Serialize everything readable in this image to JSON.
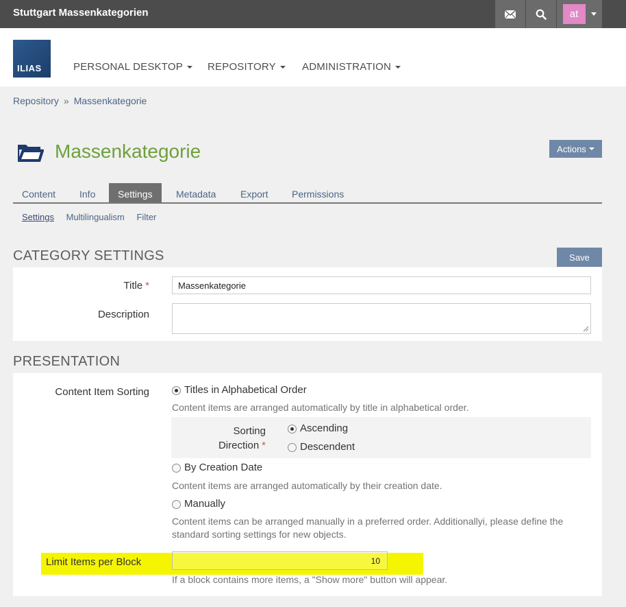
{
  "topbar": {
    "title": "Stuttgart Massenkategorien",
    "user_initials": "at"
  },
  "header": {
    "logo_text": "ILIAS",
    "nav": [
      {
        "label": "PERSONAL DESKTOP"
      },
      {
        "label": "REPOSITORY"
      },
      {
        "label": "ADMINISTRATION"
      }
    ]
  },
  "breadcrumb": {
    "items": [
      "Repository",
      "Massenkategorie"
    ],
    "separator": "»"
  },
  "page": {
    "title": "Massenkategorie",
    "actions_label": "Actions"
  },
  "tabs": [
    {
      "label": "Content"
    },
    {
      "label": "Info"
    },
    {
      "label": "Settings",
      "active": true
    },
    {
      "label": "Metadata"
    },
    {
      "label": "Export"
    },
    {
      "label": "Permissions"
    }
  ],
  "subtabs": [
    {
      "label": "Settings",
      "active": true
    },
    {
      "label": "Multilingualism"
    },
    {
      "label": "Filter"
    }
  ],
  "category_settings": {
    "heading": "CATEGORY SETTINGS",
    "save_label": "Save",
    "title_label": "Title",
    "required_mark": "*",
    "title_value": "Massenkategorie",
    "description_label": "Description",
    "description_value": ""
  },
  "presentation": {
    "heading": "PRESENTATION",
    "sorting_label": "Content Item Sorting",
    "options": {
      "alpha": {
        "label": "Titles in Alphabetical Order",
        "help": "Content items are arranged automatically by title in alphabetical order.",
        "selected": true
      },
      "creation": {
        "label": "By Creation Date",
        "help": "Content items are arranged automatically by their creation date.",
        "selected": false
      },
      "manual": {
        "label": "Manually",
        "help_line1": "Content items can be arranged manually in a preferred order. Additionallyi, please define the",
        "help_line2": "standard sorting settings for new objects.",
        "selected": false
      }
    },
    "direction": {
      "label_line1": "Sorting",
      "label_line2": "Direction",
      "required_mark": "*",
      "ascending": "Ascending",
      "descendent": "Descendent",
      "selected": "ascending"
    },
    "limit": {
      "label": "Limit Items per Block",
      "value": "10",
      "help": "If a block contains more items, a \"Show more\" button will appear."
    }
  },
  "colors": {
    "topbar": "#4c4c4c",
    "title_green": "#6ea03c",
    "button_blue": "#6f88a8",
    "link_blue": "#4c6586",
    "highlight": "#f5f500",
    "avatar": "#e289c6"
  }
}
